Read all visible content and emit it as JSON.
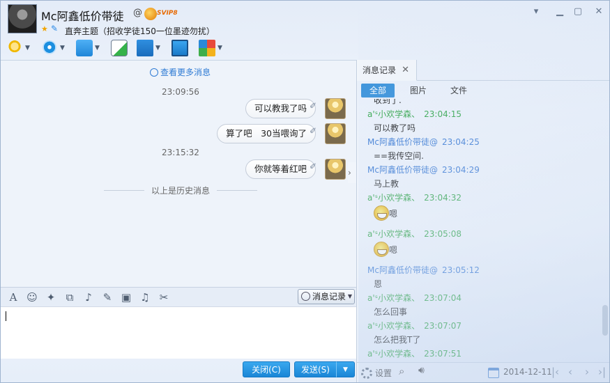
{
  "header": {
    "nickname": "Mc阿鑫低价带徒",
    "at_symbol": "@",
    "vip_label": "SVIP8",
    "signature": "直奔主题（招收学徒150一位墨迹勿扰）",
    "icons": [
      "microphone-icon",
      "camera-icon",
      "folder-transfer-icon",
      "note-add-icon",
      "remote-desktop-icon",
      "screen-share-icon",
      "apps-grid-icon"
    ]
  },
  "window_controls": [
    "dropdown-icon",
    "minimize-icon",
    "maximize-icon",
    "close-icon"
  ],
  "chat": {
    "view_more": "查看更多消息",
    "messages": [
      {
        "time": "23:09:56",
        "text": "可以教我了吗"
      },
      {
        "time": "",
        "text": "算了吧　30当喂询了"
      },
      {
        "time": "23:15:32",
        "text": "你就等着红吧"
      }
    ],
    "history_divider": "以上是历史消息"
  },
  "format_toolbar": {
    "icons": [
      "font-icon",
      "emoji-icon",
      "magic-icon",
      "screenshot-icon",
      "voice-icon",
      "edit-icon",
      "image-icon",
      "music-icon",
      "scissors-icon"
    ],
    "history_button": "消息记录"
  },
  "input": {
    "value": ""
  },
  "buttons": {
    "close": "关闭(C)",
    "send": "发送(S)"
  },
  "history_panel": {
    "tab_title": "消息记录",
    "filters": [
      "全部",
      "图片",
      "文件"
    ],
    "entries": [
      {
        "kind": "msg",
        "text": "收到了."
      },
      {
        "kind": "buddy",
        "name": "a'ˢ小欢学森、",
        "time": "23:04:15"
      },
      {
        "kind": "msg",
        "text": "可以教了吗"
      },
      {
        "kind": "me",
        "name": "Mc阿鑫低价带徒@",
        "time": "23:04:25"
      },
      {
        "kind": "msg",
        "text": "==我传空间."
      },
      {
        "kind": "me",
        "name": "Mc阿鑫低价带徒@",
        "time": "23:04:29"
      },
      {
        "kind": "msg",
        "text": "马上教"
      },
      {
        "kind": "buddy",
        "name": "a'ˢ小欢学森、",
        "time": "23:04:32"
      },
      {
        "kind": "emoji",
        "text": "嗯"
      },
      {
        "kind": "buddy",
        "name": "a'ˢ小欢学森、",
        "time": "23:05:08"
      },
      {
        "kind": "emoji",
        "text": "嗯"
      },
      {
        "kind": "me",
        "name": "Mc阿鑫低价带徒@",
        "time": "23:05:12"
      },
      {
        "kind": "msg",
        "text": "恩"
      },
      {
        "kind": "buddy",
        "name": "a'ˢ小欢学森、",
        "time": "23:07:04"
      },
      {
        "kind": "msg",
        "text": "怎么回事"
      },
      {
        "kind": "buddy",
        "name": "a'ˢ小欢学森、",
        "time": "23:07:07"
      },
      {
        "kind": "msg",
        "text": "怎么把我T了"
      },
      {
        "kind": "buddy",
        "name": "a'ˢ小欢学森、",
        "time": "23:07:51"
      }
    ],
    "settings_label": "设置",
    "date": "2014-12-11"
  },
  "colors": {
    "accent": "#2a8ad8",
    "buddy_name": "#23a03a",
    "my_name": "#2a6fd0"
  }
}
